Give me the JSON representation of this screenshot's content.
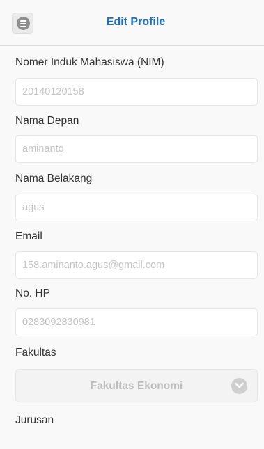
{
  "header": {
    "title": "Edit Profile",
    "menu_icon": "menu-circle-icon"
  },
  "form": {
    "nim": {
      "label": "Nomer Induk Mahasiswa (NIM)",
      "value": "20140120158"
    },
    "nama_depan": {
      "label": "Nama Depan",
      "value": "aminanto"
    },
    "nama_belakang": {
      "label": "Nama Belakang",
      "value": "agus"
    },
    "email": {
      "label": "Email",
      "value": "158.aminanto.agus@gmail.com"
    },
    "no_hp": {
      "label": "No. HP",
      "value": "0283092830981"
    },
    "fakultas": {
      "label": "Fakultas",
      "selected": "Fakultas Ekonomi",
      "icon": "chevron-down-icon"
    },
    "jurusan": {
      "label": "Jurusan"
    }
  },
  "colors": {
    "title": "#1d6fbf",
    "label": "#333333",
    "placeholder": "#c4c4c4",
    "background": "#f9f9f9"
  }
}
